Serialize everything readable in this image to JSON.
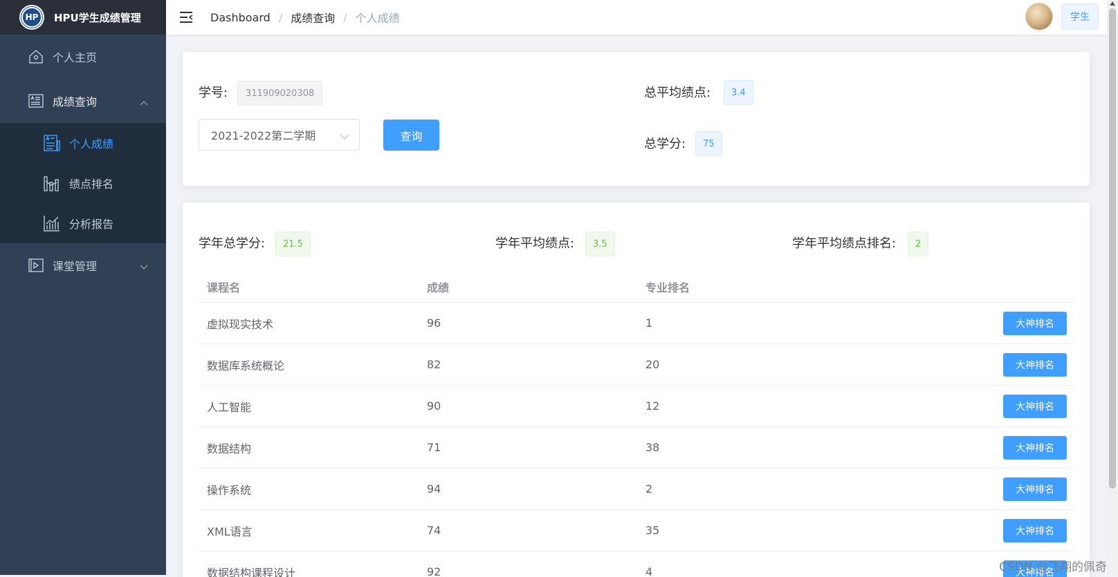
{
  "app": {
    "title": "HPU学生成绩管理"
  },
  "sidebar": {
    "items": [
      {
        "label": "个人主页",
        "icon": "home-icon"
      },
      {
        "label": "成绩查询",
        "icon": "document-icon",
        "expanded": true,
        "children": [
          {
            "label": "个人成绩",
            "icon": "score-doc-icon",
            "active": true
          },
          {
            "label": "绩点排名",
            "icon": "ranking-chart-icon"
          },
          {
            "label": "分析报告",
            "icon": "analysis-chart-icon"
          }
        ]
      },
      {
        "label": "课堂管理",
        "icon": "play-icon"
      }
    ]
  },
  "header": {
    "breadcrumb": [
      "Dashboard",
      "成绩查询",
      "个人成绩"
    ],
    "role": "学生"
  },
  "query": {
    "student_id_label": "学号:",
    "student_id": "311909020308",
    "semester": "2021-2022第二学期",
    "query_button": "查询",
    "total_gpa_label": "总平均绩点:",
    "total_gpa": "3.4",
    "total_credits_label": "总学分:",
    "total_credits": "75"
  },
  "year_stats": {
    "credits_label": "学年总学分:",
    "credits": "21.5",
    "gpa_label": "学年平均绩点:",
    "gpa": "3.5",
    "gpa_rank_label": "学年平均绩点排名:",
    "gpa_rank": "2"
  },
  "table": {
    "headers": [
      "课程名",
      "成绩",
      "专业排名"
    ],
    "action_label": "大神排名",
    "rows": [
      {
        "course": "虚拟现实技术",
        "score": "96",
        "rank": "1"
      },
      {
        "course": "数据库系统概论",
        "score": "82",
        "rank": "20"
      },
      {
        "course": "人工智能",
        "score": "90",
        "rank": "12"
      },
      {
        "course": "数据结构",
        "score": "71",
        "rank": "38"
      },
      {
        "course": "操作系统",
        "score": "94",
        "rank": "2"
      },
      {
        "course": "XML语言",
        "score": "74",
        "rank": "35"
      },
      {
        "course": "数据结构课程设计",
        "score": "92",
        "rank": "4"
      }
    ]
  },
  "watermark": "CSDN @飞翔的佩奇",
  "colors": {
    "sidebar": "#304156",
    "submenu": "#1f2d3d",
    "primary": "#409eff",
    "success": "#67c23a"
  }
}
